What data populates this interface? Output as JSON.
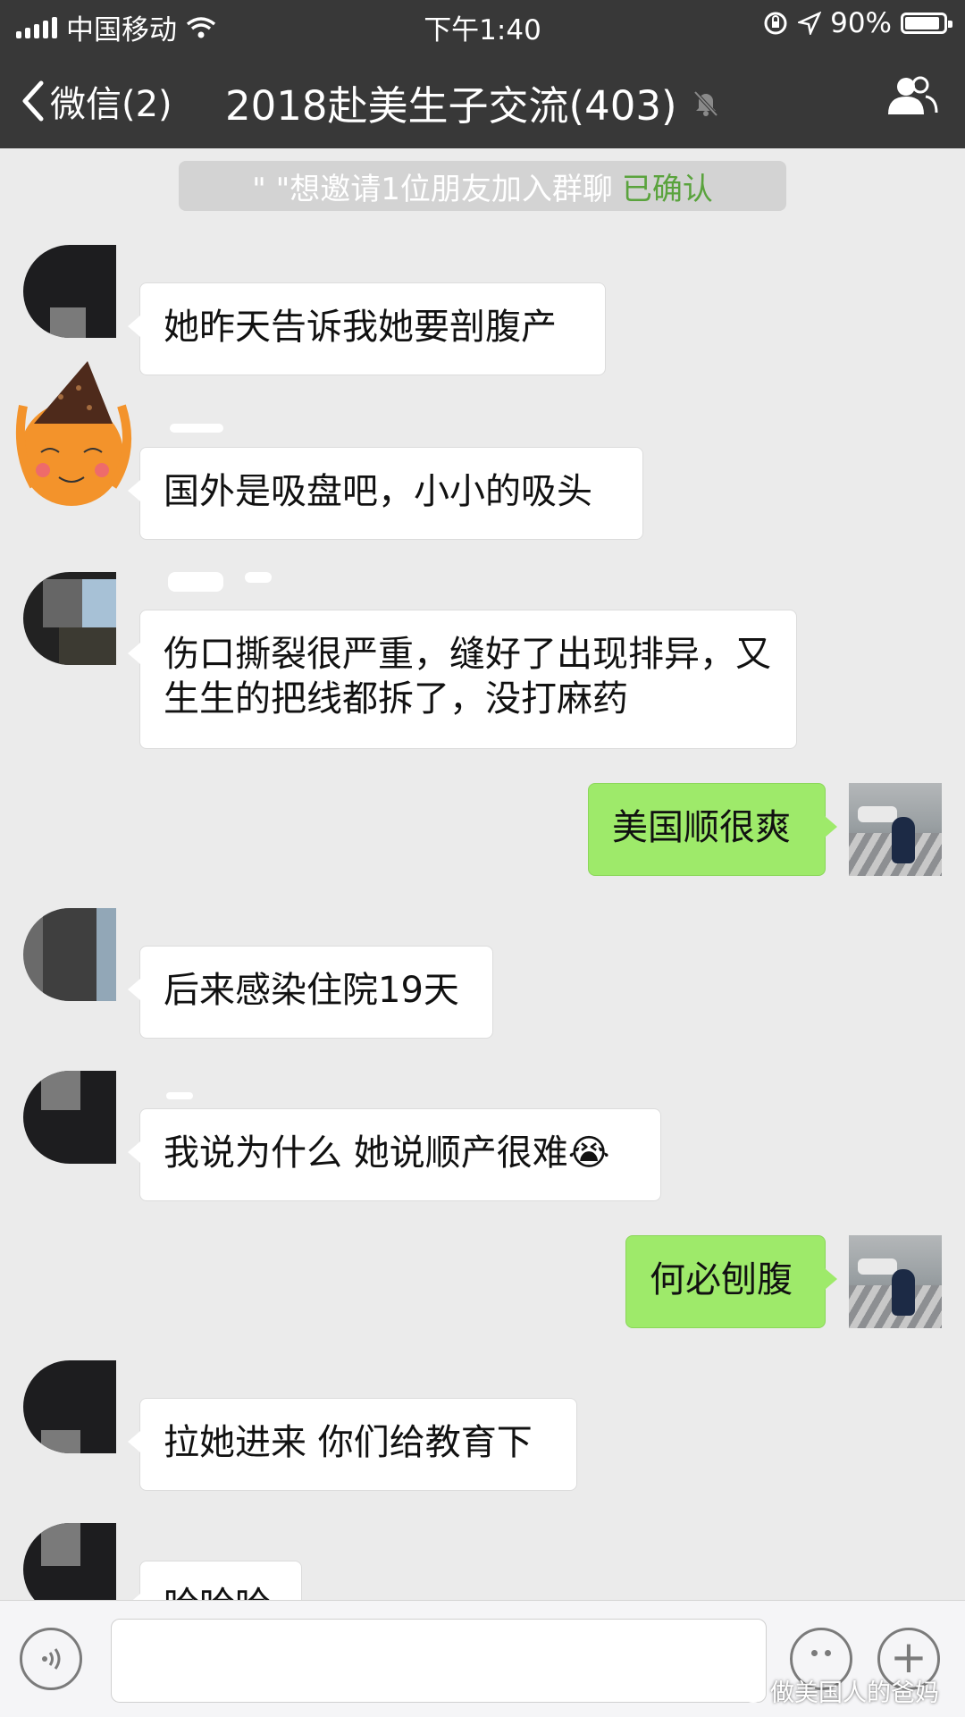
{
  "status_bar": {
    "carrier": "中国移动",
    "time": "下午1:40",
    "battery": "90%"
  },
  "nav": {
    "back_label": "微信(2)",
    "title": "2018赴美生子交流(403)"
  },
  "system_notice": {
    "text": "\"    \"想邀请1位朋友加入群聊",
    "confirmed": "已确认"
  },
  "messages": [
    {
      "side": "left",
      "text": "她昨天告诉我她要剖腹产"
    },
    {
      "side": "left",
      "text": "国外是吸盘吧，小小的吸头"
    },
    {
      "side": "left",
      "text": "伤口撕裂很严重，缝好了出现排异，又生生的把线都拆了，没打麻药"
    },
    {
      "side": "right",
      "text": "美国顺很爽"
    },
    {
      "side": "left",
      "text": "后来感染住院19天"
    },
    {
      "side": "left",
      "text": "我说为什么 她说顺产很难😭"
    },
    {
      "side": "right",
      "text": "何必刨腹"
    },
    {
      "side": "left",
      "text": "拉她进来 你们给教育下"
    },
    {
      "side": "left",
      "text": "哈哈哈"
    }
  ],
  "watermark": "做美国人的爸妈",
  "icons": [
    "back-chevron-icon",
    "mute-bell-icon",
    "group-members-icon",
    "voice-icon",
    "emoji-icon",
    "plus-icon",
    "wifi-icon",
    "location-icon",
    "rotation-lock-icon"
  ]
}
